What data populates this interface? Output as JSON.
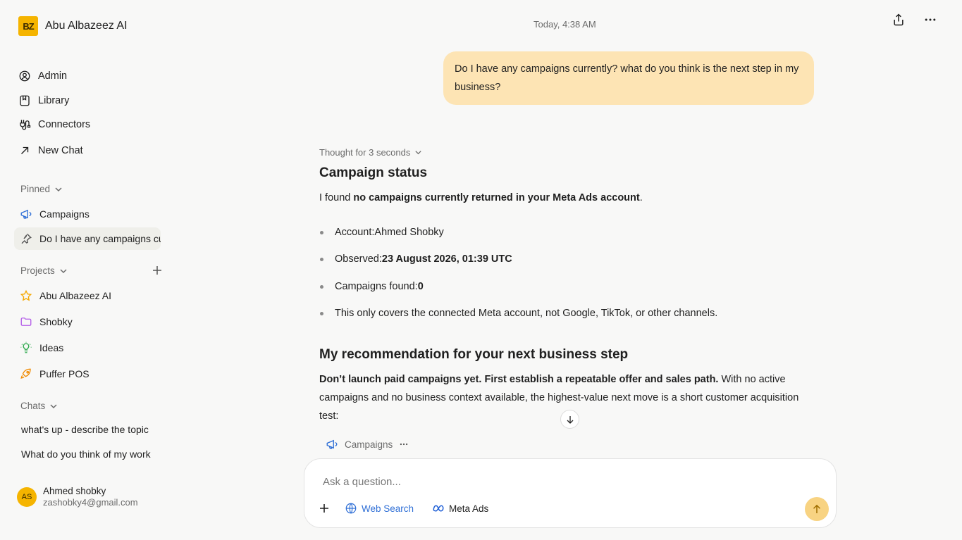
{
  "brand": {
    "logo_text": "BZ",
    "name": "Abu Albazeez AI"
  },
  "nav": [
    {
      "label": "Admin",
      "icon": "admin-gear-icon"
    },
    {
      "label": "Library",
      "icon": "library-icon"
    },
    {
      "label": "Connectors",
      "icon": "connectors-icon"
    },
    {
      "label": "New Chat",
      "icon": "arrow-up-right-icon"
    }
  ],
  "pinned": {
    "title": "Pinned",
    "items": [
      {
        "label": "Campaigns",
        "icon": "megaphone-icon"
      },
      {
        "label": "Do I have any campaigns currently?",
        "icon": "pin-icon"
      }
    ]
  },
  "projects": {
    "title": "Projects",
    "items": [
      {
        "label": "Abu Albazeez AI",
        "icon": "star-icon"
      },
      {
        "label": "Shobky",
        "icon": "folder-icon"
      },
      {
        "label": "Ideas",
        "icon": "lightbulb-icon"
      },
      {
        "label": "Puffer POS",
        "icon": "rocket-icon"
      }
    ]
  },
  "chats": {
    "title": "Chats",
    "items": [
      {
        "label": "what's up - describe the topic"
      },
      {
        "label": "What do you think of my work"
      }
    ]
  },
  "user": {
    "initials": "AS",
    "name": "Ahmed shobky",
    "email": "zashobky4@gmail.com"
  },
  "header": {
    "timestamp": "Today, 4:38 AM"
  },
  "conversation": {
    "user_message": "Do I have any campaigns currently? what do you think is the next step in my business?",
    "thought": "Thought for 3 seconds",
    "heading1": "Campaign status",
    "p1_pre": "I found ",
    "p1_bold": "no campaigns currently returned in your Meta Ads account",
    "p1_post": ".",
    "bullets": [
      {
        "pre": "Account: ",
        "bold": "",
        "value": "Ahmed Shobky"
      },
      {
        "pre": "Observed: ",
        "bold": "23 August 2026, 01:39 UTC",
        "value": ""
      },
      {
        "pre": "Campaigns found: ",
        "bold": "0",
        "value": ""
      },
      {
        "pre": "This only covers the connected Meta account, not Google, TikTok, or other channels.",
        "bold": "",
        "value": ""
      }
    ],
    "heading2": "My recommendation for your next business step",
    "p2_bold": "Don’t launch paid campaigns yet. First establish a repeatable offer and sales path.",
    "p2_rest": " With no active campaigns and no business context available, the highest-value next move is a short customer acquisition test:",
    "tool_chip": "Campaigns"
  },
  "composer": {
    "placeholder": "Ask a question...",
    "web_search": "Web Search",
    "meta_ads": "Meta Ads"
  },
  "colors": {
    "accent": "#f5b400",
    "bubble": "#fde4b4",
    "link": "#2f6fd6",
    "send": "#f8d382"
  }
}
